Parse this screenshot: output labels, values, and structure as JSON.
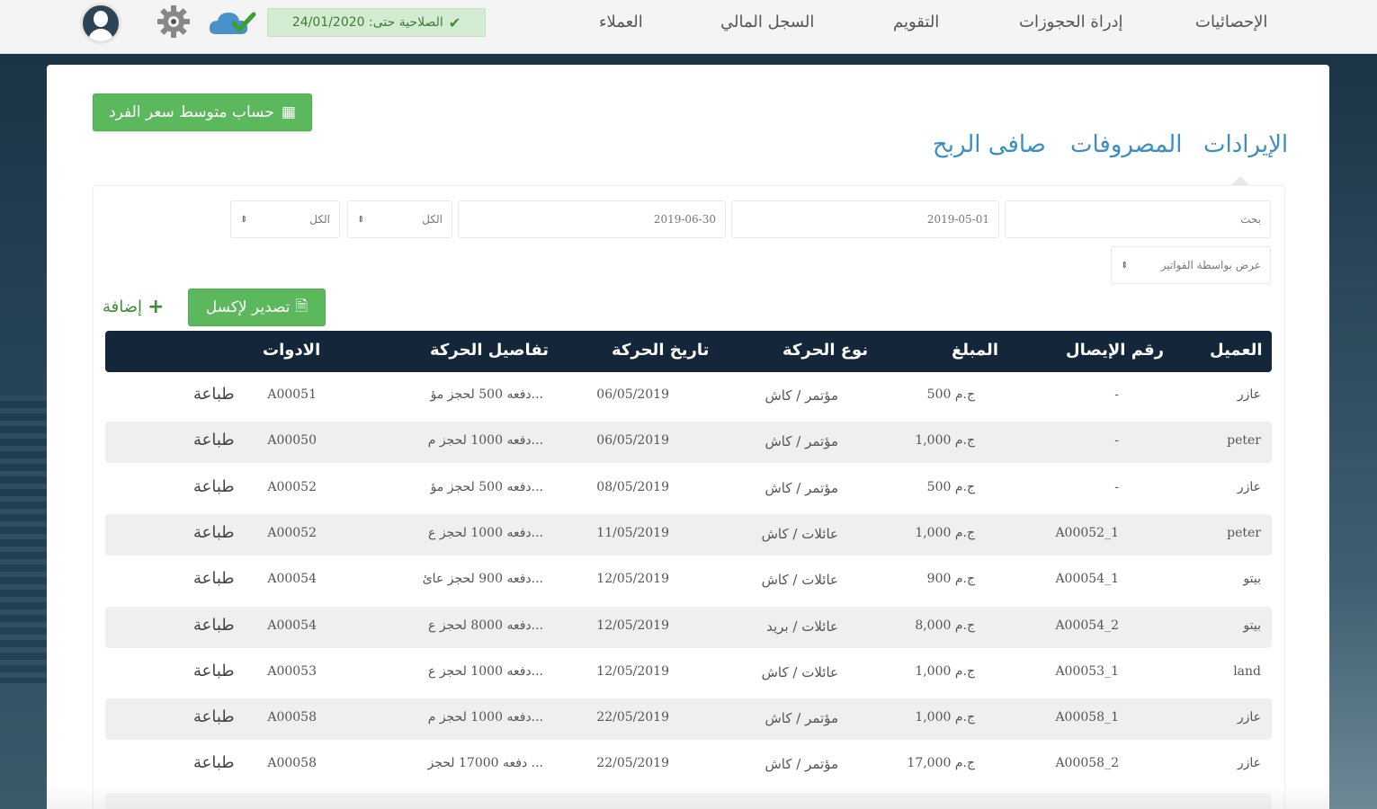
{
  "nav": {
    "items": [
      "الإحصائيات",
      "إدراة الحجوزات",
      "التقويم",
      "السجل المالي",
      "العملاء"
    ],
    "validity": "الصلاحية حتى: 24/01/2020"
  },
  "toolbar": {
    "avg_price_label": "حساب متوسط سعر الفرد",
    "export_label": "تصدير لإكسل",
    "add_label": "إضافة"
  },
  "tabs": [
    "الإيرادات",
    "المصروفات",
    "صافى الربح"
  ],
  "filters": {
    "search_placeholder": "بحث",
    "date_from": "2019-05-01",
    "date_to": "2019-06-30",
    "select_1": "الكل",
    "select_2": "الكل",
    "sort": "عرض بواسطة الفواتير"
  },
  "table": {
    "headers": [
      "العميل",
      "رقم الإيصال",
      "المبلغ",
      "نوع الحركة",
      "تاريخ الحركة",
      "تفاصيل الحركة",
      "الادوات"
    ],
    "rows": [
      {
        "client": "عازر",
        "receipt": "-",
        "amount": "500 ج.م",
        "type": "مؤتمر / كاش",
        "date": "06/05/2019",
        "details": "دفعه 500 لحجز مؤ...",
        "ref": "A00051",
        "action": "طباعة"
      },
      {
        "client": "peter",
        "receipt": "-",
        "amount": "1,000 ج.م",
        "type": "مؤتمر / كاش",
        "date": "06/05/2019",
        "details": "دفعه 1000 لحجز م...",
        "ref": "A00050",
        "action": "طباعة"
      },
      {
        "client": "عازر",
        "receipt": "-",
        "amount": "500 ج.م",
        "type": "مؤتمر / كاش",
        "date": "08/05/2019",
        "details": "دفعه 500 لحجز مؤ...",
        "ref": "A00052",
        "action": "طباعة"
      },
      {
        "client": "peter",
        "receipt": "A00052_1",
        "amount": "1,000 ج.م",
        "type": "عائلات / كاش",
        "date": "11/05/2019",
        "details": "دفعه 1000 لحجز ع...",
        "ref": "A00052",
        "action": "طباعة"
      },
      {
        "client": "بيتو",
        "receipt": "A00054_1",
        "amount": "900 ج.م",
        "type": "عائلات / كاش",
        "date": "12/05/2019",
        "details": "دفعه 900 لحجز عائ...",
        "ref": "A00054",
        "action": "طباعة"
      },
      {
        "client": "بيتو",
        "receipt": "A00054_2",
        "amount": "8,000 ج.م",
        "type": "عائلات / بريد",
        "date": "12/05/2019",
        "details": "دفعه 8000 لحجز ع...",
        "ref": "A00054",
        "action": "طباعة"
      },
      {
        "client": "land",
        "receipt": "A00053_1",
        "amount": "1,000 ج.م",
        "type": "عائلات / كاش",
        "date": "12/05/2019",
        "details": "دفعه 1000 لحجز ع...",
        "ref": "A00053",
        "action": "طباعة"
      },
      {
        "client": "عازر",
        "receipt": "A00058_1",
        "amount": "1,000 ج.م",
        "type": "مؤتمر / كاش",
        "date": "22/05/2019",
        "details": "دفعه 1000 لحجز م...",
        "ref": "A00058",
        "action": "طباعة"
      },
      {
        "client": "عازر",
        "receipt": "A00058_2",
        "amount": "17,000 ج.م",
        "type": "مؤتمر / كاش",
        "date": "22/05/2019",
        "details": "دفعه 17000 لحجز ...",
        "ref": "A00058",
        "action": "طباعة"
      }
    ]
  },
  "colors": {
    "accent_green": "#5cb85c",
    "tab_blue": "#3b8ec2",
    "table_header": "#14273a"
  }
}
